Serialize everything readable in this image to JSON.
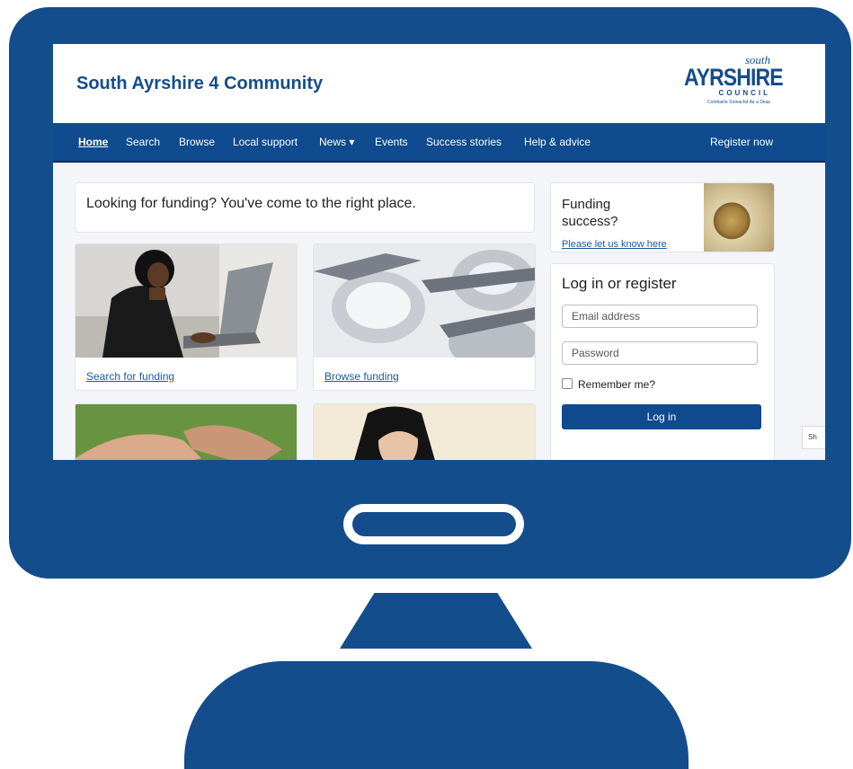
{
  "site": {
    "title": "South Ayrshire 4 Community"
  },
  "logo": {
    "south": "south",
    "main": "AYRSHIRE",
    "council": "COUNCIL",
    "gaelic": "Comhairle Sìonachd Àir a Deas"
  },
  "nav": {
    "items": [
      "Home",
      "Search",
      "Browse",
      "Local support",
      "News ▾",
      "Events",
      "Success stories",
      "Help & advice"
    ],
    "register": "Register now"
  },
  "welcome": "Looking for funding? You've come to the right place.",
  "cards": [
    {
      "link": "Search for funding"
    },
    {
      "link": "Browse funding"
    }
  ],
  "funding_success": {
    "title": "Funding success?",
    "link": "Please let us know here"
  },
  "login": {
    "title": "Log in or register",
    "email_placeholder": "Email address",
    "password_placeholder": "Password",
    "remember": "Remember me?",
    "button": "Log in"
  },
  "side_tab": "Sh",
  "colors": {
    "monitor": "#144d8c",
    "nav": "#0f4b8e",
    "title": "#144d8c"
  }
}
